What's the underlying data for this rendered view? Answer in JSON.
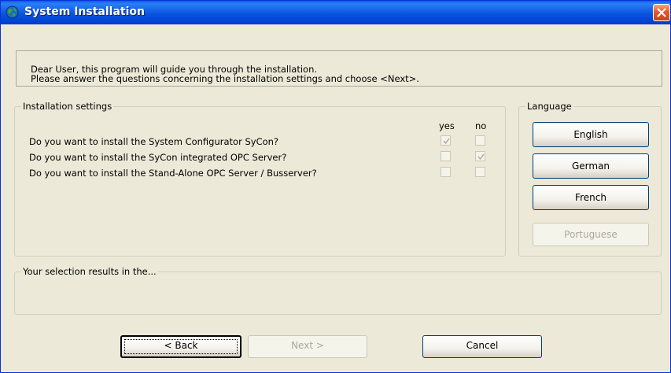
{
  "window": {
    "title": "System Installation"
  },
  "intro": {
    "line1": "Dear User, this program will guide you through the installation.",
    "line2": "Please answer the questions concerning the installation settings and choose <Next>."
  },
  "settings": {
    "group_label": "Installation settings",
    "col_yes": "yes",
    "col_no": "no",
    "questions": [
      {
        "text": "Do you want to install the System Configurator SyCon?",
        "yes": true,
        "no": false
      },
      {
        "text": "Do you want to install the SyCon integrated OPC Server?",
        "yes": false,
        "no": true
      },
      {
        "text": "Do you want to install the Stand-Alone OPC Server / Busserver?",
        "yes": false,
        "no": false
      }
    ]
  },
  "language": {
    "group_label": "Language",
    "buttons": [
      {
        "label": "English",
        "enabled": true
      },
      {
        "label": "German",
        "enabled": true
      },
      {
        "label": "French",
        "enabled": true
      },
      {
        "label": "Portuguese",
        "enabled": false
      }
    ]
  },
  "result": {
    "group_label": "Your selection results in the..."
  },
  "footer": {
    "back_label": "< Back",
    "next_label": "Next >",
    "cancel_label": "Cancel"
  },
  "colors": {
    "titlebar": "#0a54e0",
    "dialog_bg": "#ece9d8",
    "close_button": "#e35a2c"
  }
}
